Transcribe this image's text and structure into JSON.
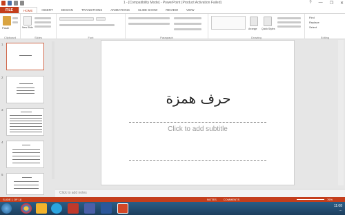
{
  "window": {
    "title": "1 - [Compatibility Mode] - PowerPoint (Product Activation Failed)",
    "controls": [
      "?",
      "—",
      "❐",
      "✕"
    ]
  },
  "tabs": [
    "FILE",
    "HOME",
    "INSERT",
    "DESIGN",
    "TRANSITIONS",
    "ANIMATIONS",
    "SLIDE SHOW",
    "REVIEW",
    "VIEW"
  ],
  "ribbon": {
    "groups": [
      "Clipboard",
      "Slides",
      "Font",
      "Paragraph",
      "Drawing",
      "Editing"
    ],
    "paste_label": "Paste",
    "new_slide_label": "New Slide",
    "arrange_label": "Arrange",
    "quick_styles_label": "Quick Styles",
    "find_label": "Find",
    "replace_label": "Replace",
    "select_label": "Select"
  },
  "thumbnails": [
    {
      "num": "1",
      "selected": true
    },
    {
      "num": "2",
      "selected": false
    },
    {
      "num": "3",
      "selected": false
    },
    {
      "num": "4",
      "selected": false
    },
    {
      "num": "5",
      "selected": false
    }
  ],
  "slide": {
    "title": "حرف همزة",
    "subtitle_placeholder": "Click to add subtitle"
  },
  "notes_placeholder": "Click to add notes",
  "statusbar": {
    "left": "SLIDE 1 OF 18",
    "notes": "NOTES",
    "comments": "COMMENTS",
    "zoom": "76%"
  },
  "taskbar": {
    "time": "11:08",
    "date": "…"
  },
  "colors": {
    "accent": "#c43e1c",
    "taskbar": "#1d3f5e"
  }
}
